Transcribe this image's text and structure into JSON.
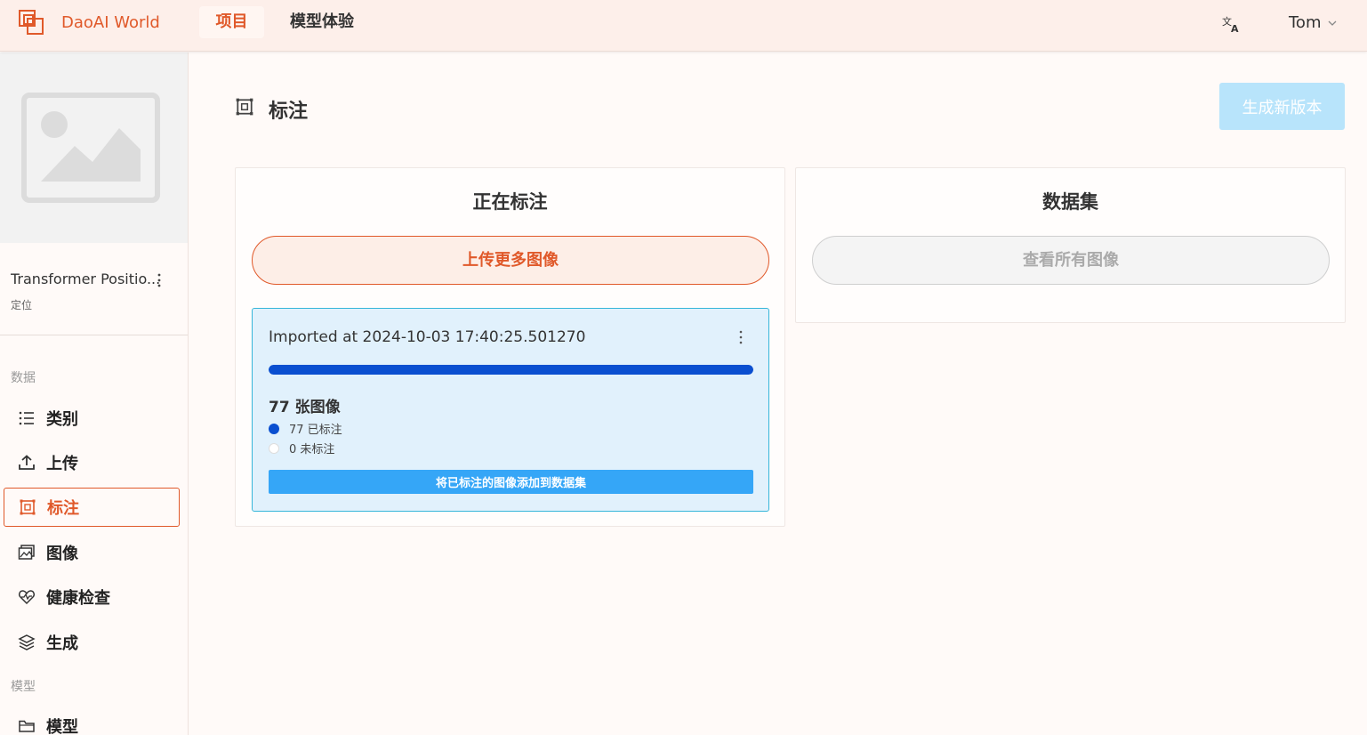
{
  "header": {
    "brand": "DaoAI World",
    "tabs": [
      {
        "label": "项目",
        "active": true
      },
      {
        "label": "模型体验",
        "active": false
      }
    ],
    "language_icon": "translate-icon",
    "user_name": "Tom"
  },
  "sidebar": {
    "project_name": "Transformer Positio...",
    "project_type": "定位",
    "sections": {
      "data_label": "数据",
      "model_label": "模型"
    },
    "items": [
      {
        "label": "类别",
        "icon": "list-icon"
      },
      {
        "label": "上传",
        "icon": "upload-icon"
      },
      {
        "label": "标注",
        "icon": "annotate-icon",
        "active": true
      },
      {
        "label": "图像",
        "icon": "images-icon"
      },
      {
        "label": "健康检查",
        "icon": "heart-pulse-icon"
      },
      {
        "label": "生成",
        "icon": "layers-icon"
      },
      {
        "label": "模型",
        "icon": "folder-icon"
      }
    ]
  },
  "main": {
    "title": "标注",
    "generate_button": "生成新版本",
    "annotating_panel": {
      "title": "正在标注",
      "upload_button": "上传更多图像",
      "batch": {
        "title": "Imported at 2024-10-03 17:40:25.501270",
        "progress": 1.0,
        "image_count": "77 张图像",
        "annotated": "77 已标注",
        "unannotated": "0 未标注",
        "add_button": "将已标注的图像添加到数据集"
      }
    },
    "dataset_panel": {
      "title": "数据集",
      "view_button": "查看所有图像"
    }
  },
  "colors": {
    "accent": "#e0592a",
    "header_bg": "#fdefea",
    "progress": "#0a4fd0",
    "primary_button": "#35a6f7",
    "disabled_button": "#b8e4fb"
  }
}
